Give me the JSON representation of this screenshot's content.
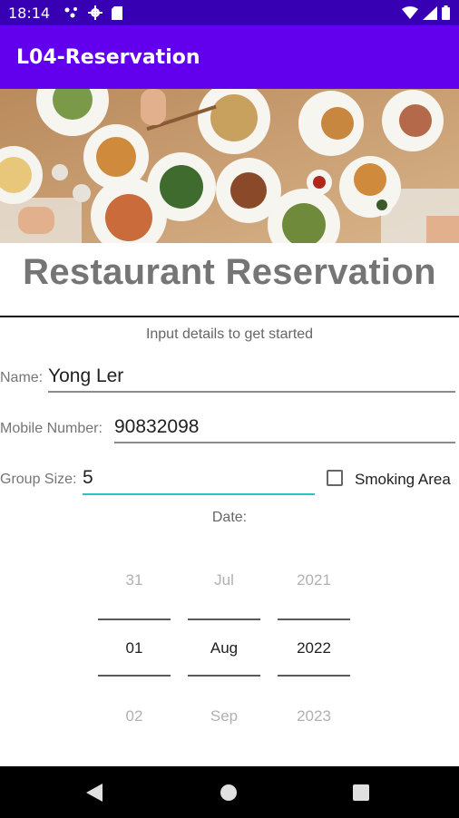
{
  "status": {
    "time": "18:14"
  },
  "app_bar": {
    "title": "L04-Reservation"
  },
  "page": {
    "title": "Restaurant Reservation",
    "subtitle": "Input details to get started"
  },
  "form": {
    "name_label": "Name:",
    "name_value": "Yong Ler",
    "mobile_label": "Mobile Number:",
    "mobile_value": "90832098",
    "group_label": "Group Size:",
    "group_value": "5",
    "smoking_label": "Smoking Area",
    "smoking_checked": false,
    "date_label": "Date:"
  },
  "date_picker": {
    "day": {
      "prev": "31",
      "selected": "01",
      "next": "02"
    },
    "month": {
      "prev": "Jul",
      "selected": "Aug",
      "next": "Sep"
    },
    "year": {
      "prev": "2021",
      "selected": "2022",
      "next": "2023"
    }
  },
  "colors": {
    "status_bar": "#3700b3",
    "app_bar": "#6200ee",
    "focus_accent": "#26c6c0"
  },
  "icons": {
    "status_left": [
      "notification-dots-icon",
      "settings-gear-icon",
      "sd-card-icon"
    ],
    "status_right": [
      "wifi-icon",
      "signal-icon",
      "battery-icon"
    ],
    "nav": [
      "back-icon",
      "home-icon",
      "recents-icon"
    ]
  }
}
